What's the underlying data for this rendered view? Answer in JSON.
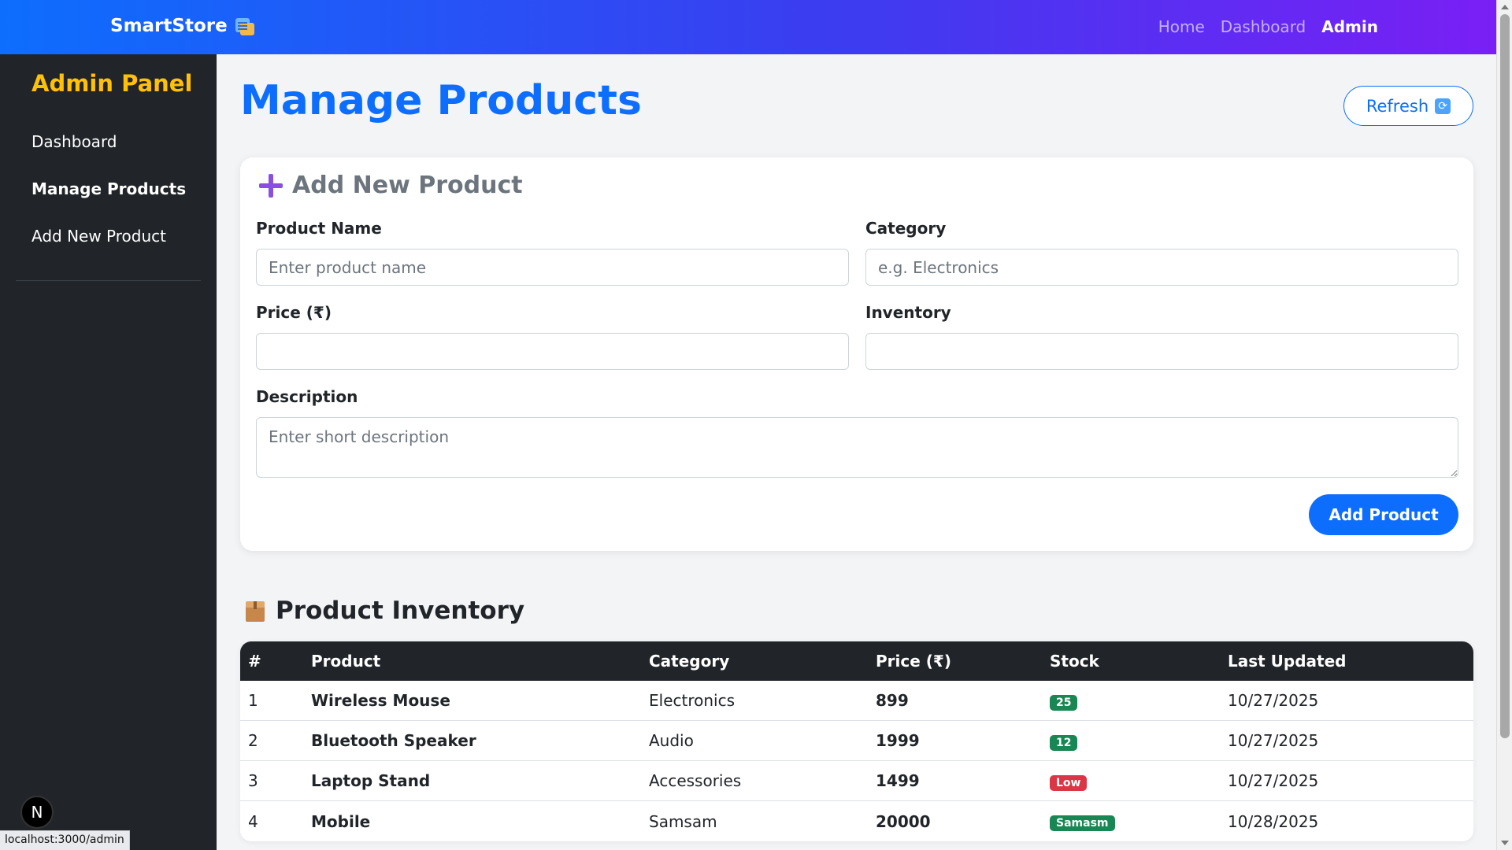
{
  "nav": {
    "brand": "SmartStore",
    "brand_icon": "books-icon",
    "links": [
      {
        "label": "Home",
        "active": false
      },
      {
        "label": "Dashboard",
        "active": false
      },
      {
        "label": "Admin",
        "active": true
      }
    ]
  },
  "sidebar": {
    "title": "Admin Panel",
    "items": [
      {
        "label": "Dashboard",
        "active": false
      },
      {
        "label": "Manage Products",
        "active": true
      },
      {
        "label": "Add New Product",
        "active": false
      }
    ]
  },
  "page": {
    "title": "Manage Products",
    "refresh_label": "Refresh",
    "refresh_icon": "refresh-icon"
  },
  "form": {
    "heading": "Add New Product",
    "heading_icon": "plus-icon",
    "product_name": {
      "label": "Product Name",
      "placeholder": "Enter product name",
      "value": ""
    },
    "category": {
      "label": "Category",
      "placeholder": "e.g. Electronics",
      "value": ""
    },
    "price": {
      "label": "Price (₹)",
      "placeholder": "",
      "value": ""
    },
    "inventory": {
      "label": "Inventory",
      "placeholder": "",
      "value": ""
    },
    "description": {
      "label": "Description",
      "placeholder": "Enter short description",
      "value": ""
    },
    "submit_label": "Add Product"
  },
  "inventory": {
    "heading": "Product Inventory",
    "heading_icon": "package-icon",
    "columns": [
      "#",
      "Product",
      "Category",
      "Price (₹)",
      "Stock",
      "Last Updated"
    ],
    "rows": [
      {
        "num": "1",
        "product": "Wireless Mouse",
        "category": "Electronics",
        "price": "899",
        "stock": "25",
        "stock_status": "ok",
        "updated": "10/27/2025"
      },
      {
        "num": "2",
        "product": "Bluetooth Speaker",
        "category": "Audio",
        "price": "1999",
        "stock": "12",
        "stock_status": "ok",
        "updated": "10/27/2025"
      },
      {
        "num": "3",
        "product": "Laptop Stand",
        "category": "Accessories",
        "price": "1499",
        "stock": "Low",
        "stock_status": "low",
        "updated": "10/27/2025"
      },
      {
        "num": "4",
        "product": "Mobile",
        "category": "Samsam",
        "price": "20000",
        "stock": "Samasm",
        "stock_status": "ok",
        "updated": "10/28/2025"
      }
    ]
  },
  "colors": {
    "primary": "#0d6efd",
    "sidebar_bg": "#212529",
    "sidebar_title": "#ffc107",
    "price": "#198754",
    "badge_ok": "#198754",
    "badge_low": "#dc3545"
  },
  "devtools_badge": "N",
  "status_url": "localhost:3000/admin"
}
